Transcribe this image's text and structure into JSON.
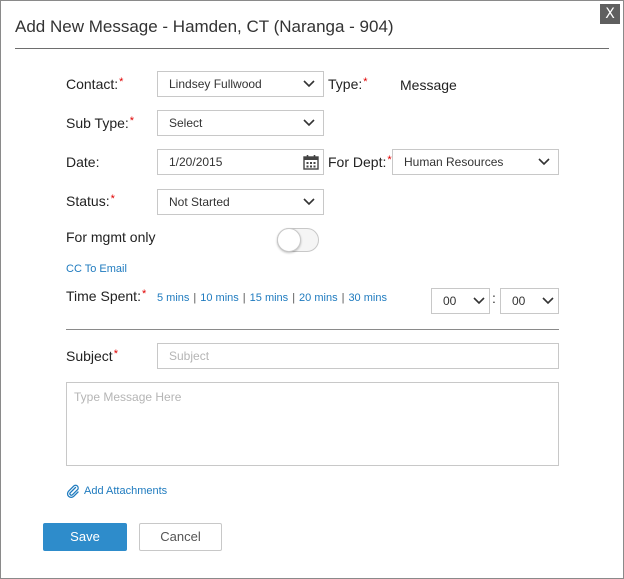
{
  "dialog": {
    "title": "Add New Message - Hamden, CT (Naranga - 904)",
    "close_label": "X"
  },
  "form": {
    "required_mark": "*",
    "contact": {
      "label": "Contact:",
      "value": "Lindsey Fullwood"
    },
    "type": {
      "label": "Type:",
      "value": "Message"
    },
    "sub_type": {
      "label": "Sub Type:",
      "value": "Select"
    },
    "date": {
      "label": "Date:",
      "value": "1/20/2015"
    },
    "for_dept": {
      "label": "For Dept:",
      "value": "Human Resources"
    },
    "status": {
      "label": "Status:",
      "value": "Not Started"
    },
    "mgmt_only": {
      "label": "For mgmt only"
    },
    "cc_to_email": "CC To Email",
    "time_spent": {
      "label": "Time Spent:",
      "presets": [
        "5 mins",
        "10 mins",
        "15 mins",
        "20 mins",
        "30 mins"
      ],
      "hours": "00",
      "minutes": "00",
      "separator": ":"
    },
    "subject": {
      "label": "Subject",
      "placeholder": "Subject"
    },
    "message": {
      "placeholder": "Type Message Here"
    },
    "add_attachments": "Add Attachments"
  },
  "buttons": {
    "save": "Save",
    "cancel": "Cancel"
  },
  "colors": {
    "primary": "#2e8ccb",
    "link": "#1f7bbf",
    "required": "#e00000"
  }
}
